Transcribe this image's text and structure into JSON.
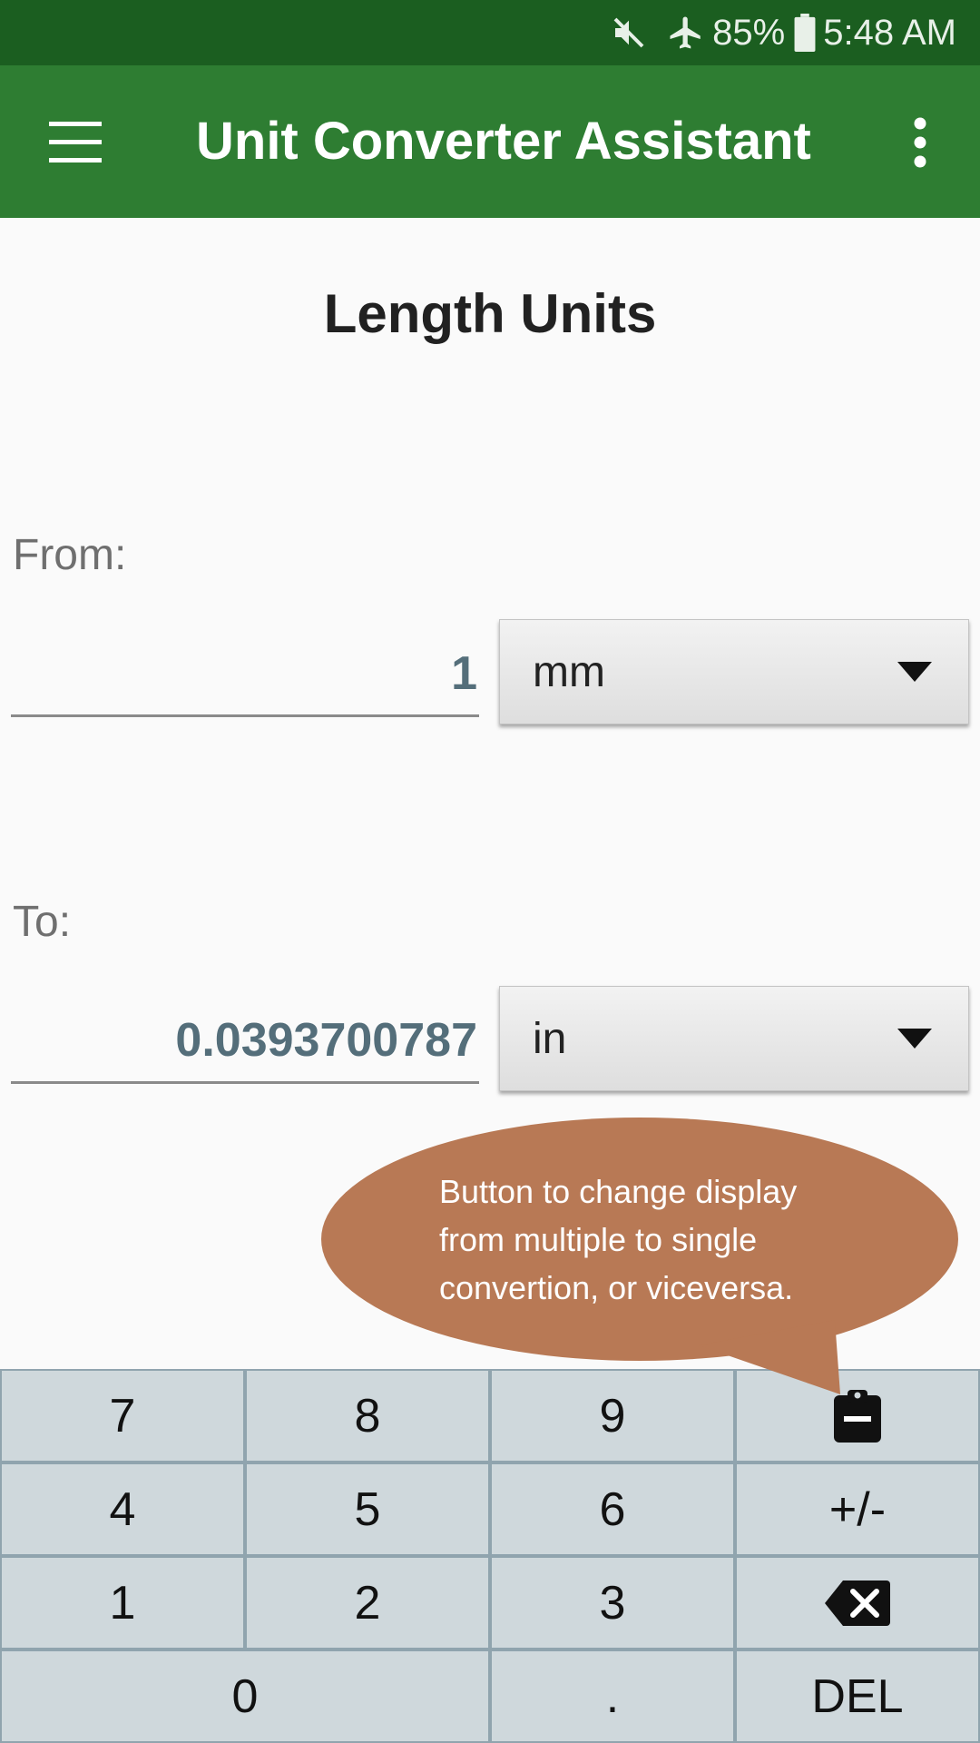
{
  "status_bar": {
    "battery": "85%",
    "time": "5:48 AM",
    "icons": [
      "mute-icon",
      "airplane-icon",
      "battery-icon"
    ]
  },
  "app_bar": {
    "title": "Unit Converter Assistant",
    "icons": [
      "hamburger-menu-icon",
      "more-vert-icon"
    ]
  },
  "main": {
    "heading": "Length Units",
    "from": {
      "label": "From:",
      "value": "1",
      "unit": "mm"
    },
    "to": {
      "label": "To:",
      "value": "0.0393700787",
      "unit": "in"
    }
  },
  "callout": {
    "text": "Button to change display from multiple to single convertion, or viceversa.",
    "color": "#b87955"
  },
  "keypad": {
    "rows": [
      [
        "7",
        "8",
        "9",
        "clipboard-icon"
      ],
      [
        "4",
        "5",
        "6",
        "+/-"
      ],
      [
        "1",
        "2",
        "3",
        "backspace-icon"
      ],
      [
        "0",
        ".",
        "DEL"
      ]
    ],
    "k7": "7",
    "k8": "8",
    "k9": "9",
    "k4": "4",
    "k5": "5",
    "k6": "6",
    "plusminus": "+/-",
    "k1": "1",
    "k2": "2",
    "k3": "3",
    "k0": "0",
    "dot": ".",
    "del": "DEL"
  },
  "colors": {
    "status_bar": "#1b5e20",
    "app_bar": "#2e7d32",
    "value_text": "#546e7a",
    "key_bg": "#cfd8dc",
    "key_border": "#90a4ae"
  }
}
